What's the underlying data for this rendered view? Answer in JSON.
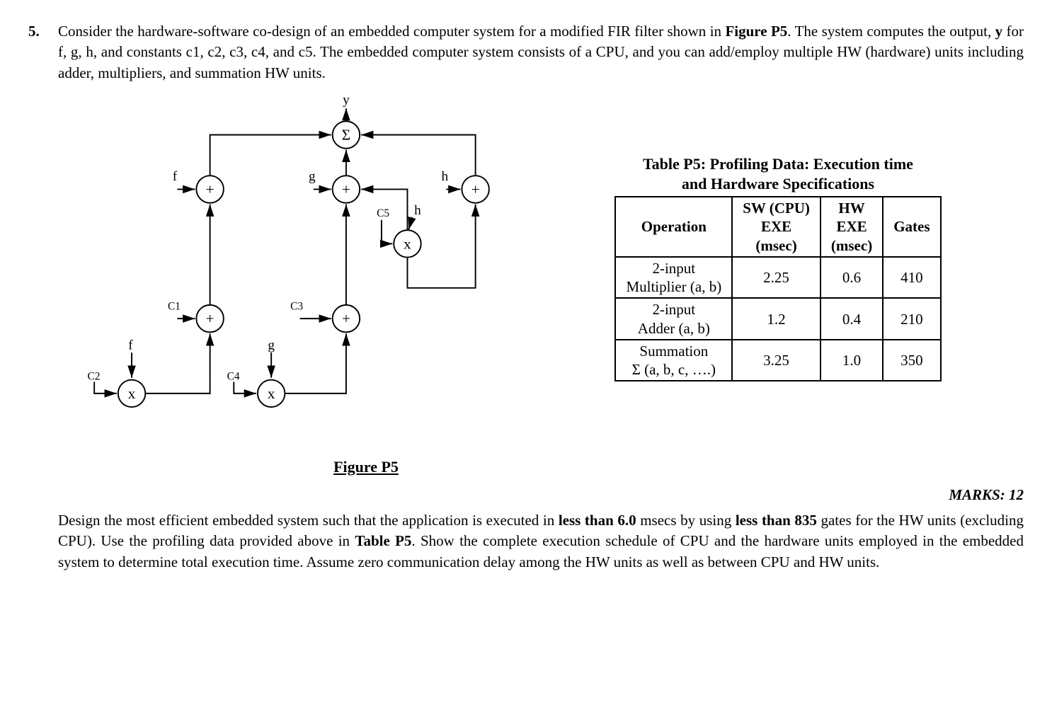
{
  "question": {
    "number": "5.",
    "intro_html": "Consider the hardware-software co-design of an embedded computer system for a modified FIR filter shown in <b>Figure P5</b>. The system computes the output, <b>y</b> for f, g, h, and constants c1, c2, c3, c4, and c5. The embedded computer system consists of a CPU, and you can add/employ multiple HW (hardware) units including adder, multipliers, and summation HW units.",
    "task_html": "Design the most efficient embedded system such that the application is executed in <b>less than 6.0</b> msecs by using <b>less than 835</b> gates for the HW units (excluding CPU). Use the profiling data provided above in <b>Table P5</b>. Show the complete execution schedule of CPU and the hardware units employed in the embedded system to determine total execution time. Assume zero communication delay among the HW units as well as between CPU and HW units.",
    "marks": "MARKS: 12"
  },
  "figure": {
    "caption": "Figure P5",
    "output": "y",
    "sigma": "Σ",
    "nodes": {
      "add_fL": "+",
      "add_gM": "+",
      "add_hR": "+",
      "mul_c5h": "x",
      "add_c1f": "+",
      "add_c3g": "+",
      "mul_c2f": "x",
      "mul_c4g": "x"
    },
    "labels": {
      "f_top": "f",
      "g_top": "g",
      "h_top": "h",
      "c5": "C5",
      "h_mid": "h",
      "c1": "C1",
      "c3": "C3",
      "f_low": "f",
      "g_low": "g",
      "c2": "C2",
      "c4": "C4"
    }
  },
  "table": {
    "title_l1": "Table P5: Profiling Data: Execution time",
    "title_l2": "and Hardware Specifications",
    "headers": {
      "op": "Operation",
      "sw": "SW (CPU) EXE (msec)",
      "hw": "HW EXE (msec)",
      "gates": "Gates"
    },
    "rows": [
      {
        "op_l1": "2-input",
        "op_l2": "Multiplier (a, b)",
        "sw": "2.25",
        "hw": "0.6",
        "gates": "410"
      },
      {
        "op_l1": "2-input",
        "op_l2": "Adder (a, b)",
        "sw": "1.2",
        "hw": "0.4",
        "gates": "210"
      },
      {
        "op_l1": "Summation",
        "op_l2": "Σ (a, b, c, ….)",
        "sw": "3.25",
        "hw": "1.0",
        "gates": "350"
      }
    ]
  },
  "chart_data": {
    "type": "diagram",
    "description": "Dataflow graph for a modified FIR filter computing output y",
    "nodes": [
      {
        "id": "mul_c2f",
        "op": "multiply",
        "inputs": [
          "C2",
          "f"
        ]
      },
      {
        "id": "mul_c4g",
        "op": "multiply",
        "inputs": [
          "C4",
          "g"
        ]
      },
      {
        "id": "add_c1f",
        "op": "add",
        "inputs": [
          "C1",
          "mul_c2f"
        ]
      },
      {
        "id": "add_c3g",
        "op": "add",
        "inputs": [
          "C3",
          "mul_c4g"
        ]
      },
      {
        "id": "mul_c5h",
        "op": "multiply",
        "inputs": [
          "C5",
          "h"
        ]
      },
      {
        "id": "add_fL",
        "op": "add",
        "inputs": [
          "f",
          "add_c1f"
        ]
      },
      {
        "id": "add_gM",
        "op": "add",
        "inputs": [
          "g",
          "add_c3g",
          "mul_c5h"
        ]
      },
      {
        "id": "add_hR",
        "op": "add",
        "inputs": [
          "h",
          "mul_c5h"
        ]
      },
      {
        "id": "sigma",
        "op": "summation",
        "inputs": [
          "add_fL",
          "add_gM",
          "add_hR"
        ]
      },
      {
        "id": "y",
        "op": "output",
        "inputs": [
          "sigma"
        ]
      }
    ]
  }
}
